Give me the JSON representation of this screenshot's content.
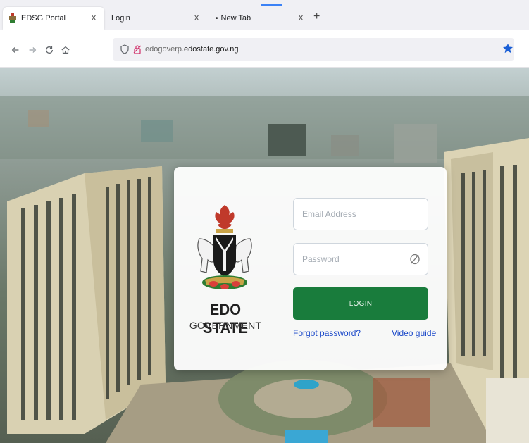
{
  "browser": {
    "tabs": [
      {
        "label": "EDSG Portal",
        "close": "X",
        "active": true
      },
      {
        "label": "Login",
        "close": "X",
        "active": false
      },
      {
        "label": "New Tab",
        "close": "X",
        "active": false,
        "indicator": "•"
      }
    ],
    "new_tab": "+",
    "address": {
      "host_prefix": "edogoverp.",
      "host_main": "edostate.gov.ng"
    },
    "icons": {
      "back": "back-arrow-icon",
      "forward": "forward-arrow-icon",
      "reload": "reload-icon",
      "home": "home-icon",
      "shield": "tracking-shield-icon",
      "site_info": "site-info-icon",
      "bookmark": "bookmark-star-icon"
    },
    "colors": {
      "bookmark": "#1a5fd6",
      "tab_highlight": "#3b82f6"
    }
  },
  "login": {
    "brand_line1": "EDO STATE",
    "brand_line2": "GOVERNMENT",
    "email_placeholder": "Email Address",
    "password_placeholder": "Password",
    "login_label": "LOGIN",
    "forgot_label": "Forgot password?",
    "video_label": "Video guide",
    "colors": {
      "button": "#197c3c",
      "link": "#1a48c9"
    }
  }
}
